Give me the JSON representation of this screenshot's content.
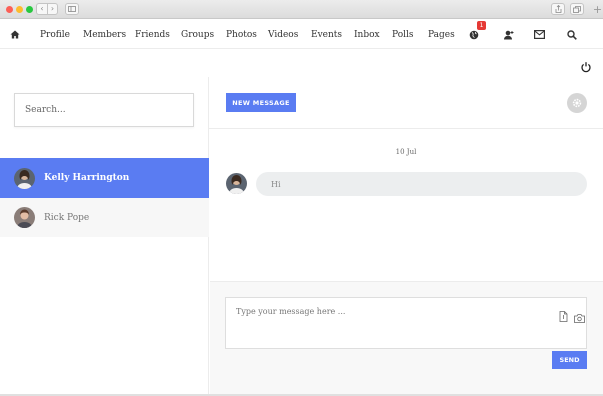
{
  "browser": {
    "back_glyph": "‹",
    "forward_glyph": "›",
    "plus_glyph": "+"
  },
  "nav": {
    "links": [
      "Profile",
      "Members",
      "Friends",
      "Groups",
      "Photos",
      "Videos",
      "Events",
      "Inbox",
      "Polls",
      "Pages"
    ],
    "notification_count": "1",
    "icons": [
      "home-icon",
      "globe-icon",
      "user-add-icon",
      "mail-icon",
      "search-icon",
      "power-icon"
    ]
  },
  "sidebar": {
    "search_placeholder": "Search...",
    "contacts": [
      {
        "name": "Kelly Harrington",
        "active": true
      },
      {
        "name": "Rick Pope",
        "active": false
      }
    ]
  },
  "chat": {
    "new_message_label": "NEW MESSAGE",
    "date": "10 Jul",
    "messages": [
      {
        "text": "Hi"
      }
    ],
    "compose_placeholder": "Type your message here ...",
    "send_label": "SEND"
  },
  "colors": {
    "accent": "#5a7cf2",
    "badge": "#e53935",
    "bubble": "#eceeef"
  }
}
